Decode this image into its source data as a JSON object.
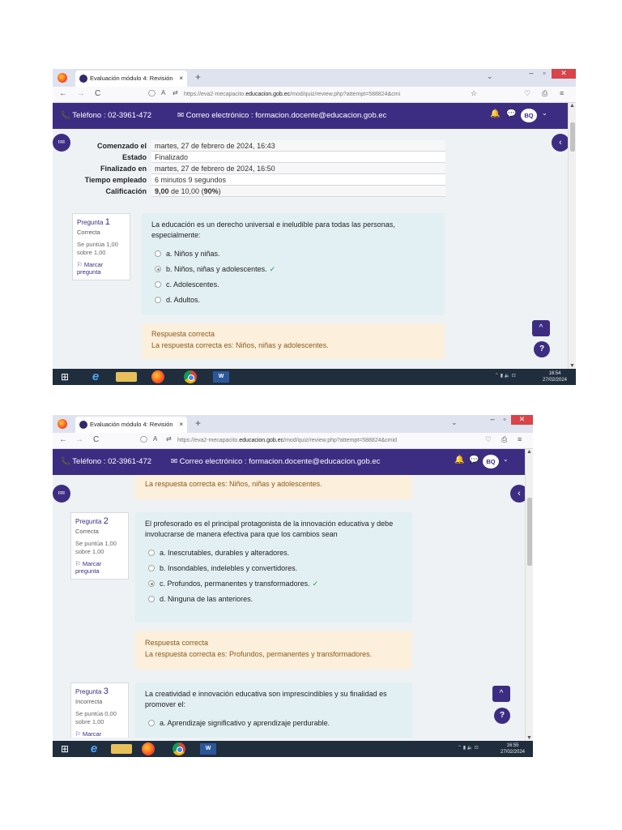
{
  "browser": {
    "tab_title": "Evaluación módulo 4: Revisión",
    "tab_close": "×",
    "new_tab": "+",
    "url_prefix": "https://eva2-mecapacito.",
    "url_domain": "educacion.gob.ec",
    "url_path": "/mod/quiz/review.php?attempt=588824&cmi",
    "url_path_2": "/mod/quiz/review.php?attempt=588824&cmid"
  },
  "header": {
    "phone": "Teléfono : 02-3961-472",
    "email": "Correo electrónico : formacion.docente@educacion.gob.ec",
    "avatar": "BQ"
  },
  "summary": [
    {
      "label": "Comenzado el",
      "value": "martes, 27 de febrero de 2024, 16:43"
    },
    {
      "label": "Estado",
      "value": "Finalizado"
    },
    {
      "label": "Finalizado en",
      "value": "martes, 27 de febrero de 2024, 16:50"
    },
    {
      "label": "Tiempo empleado",
      "value": "6 minutos 9 segundos"
    },
    {
      "label": "Calificación",
      "value_bold": "9,00",
      "value_mid": " de 10,00 (",
      "value_pct": "90%",
      "value_end": ")"
    }
  ],
  "questions": [
    {
      "label": "Pregunta",
      "number": "1",
      "status": "Correcta",
      "score": "Se puntúa 1,00 sobre 1,00",
      "flag": "Marcar pregunta",
      "text": "La educación es un derecho universal e ineludible para todas las personas, especialmente:",
      "options": [
        {
          "letter": "a.",
          "text": "Niños y niñas."
        },
        {
          "letter": "b.",
          "text": "Niños, niñas y adolescentes."
        },
        {
          "letter": "c.",
          "text": "Adolescentes."
        },
        {
          "letter": "d.",
          "text": "Adultos."
        }
      ],
      "feedback_title": "Respuesta correcta",
      "feedback_text": "La respuesta correcta es: Niños, niñas y adolescentes."
    },
    {
      "label": "Pregunta",
      "number": "2",
      "status": "Correcta",
      "score": "Se puntúa 1,00 sobre 1,00",
      "flag": "Marcar pregunta",
      "text": "El profesorado es el principal protagonista de la innovación educativa y debe involucrarse de manera efectiva para que los cambios sean",
      "options": [
        {
          "letter": "a.",
          "text": "Inescrutables, durables y alteradores."
        },
        {
          "letter": "b.",
          "text": "Insondables, indelebles y convertidores."
        },
        {
          "letter": "c.",
          "text": "Profundos, permanentes y transformadores."
        },
        {
          "letter": "d.",
          "text": "Ninguna de las anteriores."
        }
      ],
      "feedback_title": "Respuesta correcta",
      "feedback_text": "La respuesta correcta es: Profundos, permanentes y transformadores."
    },
    {
      "label": "Pregunta",
      "number": "3",
      "status": "Incorrecta",
      "score": "Se puntúa 0,00 sobre 1,00",
      "flag": "Marcar",
      "text": "La creatividad e innovación educativa son imprescindibles y su finalidad es promover el:",
      "options": [
        {
          "letter": "a.",
          "text": "Aprendizaje significativo y aprendizaje perdurable."
        }
      ]
    }
  ],
  "taskbar": [
    {
      "time": "16:54",
      "date": "27/02/2024"
    },
    {
      "time": "16:55",
      "date": "27/02/2024"
    }
  ],
  "icons": {
    "back": "←",
    "forward": "→",
    "reload": "C",
    "shield": "◯",
    "lock": "A",
    "star": "☆",
    "pocket": "♡",
    "ext": "⎙",
    "menu": "≡",
    "bell": "🔔",
    "chat": "💬",
    "caret": "˅",
    "list": "≔",
    "collapse": "‹",
    "up": "^",
    "help": "?",
    "check": "✓",
    "flag": "⚐"
  }
}
